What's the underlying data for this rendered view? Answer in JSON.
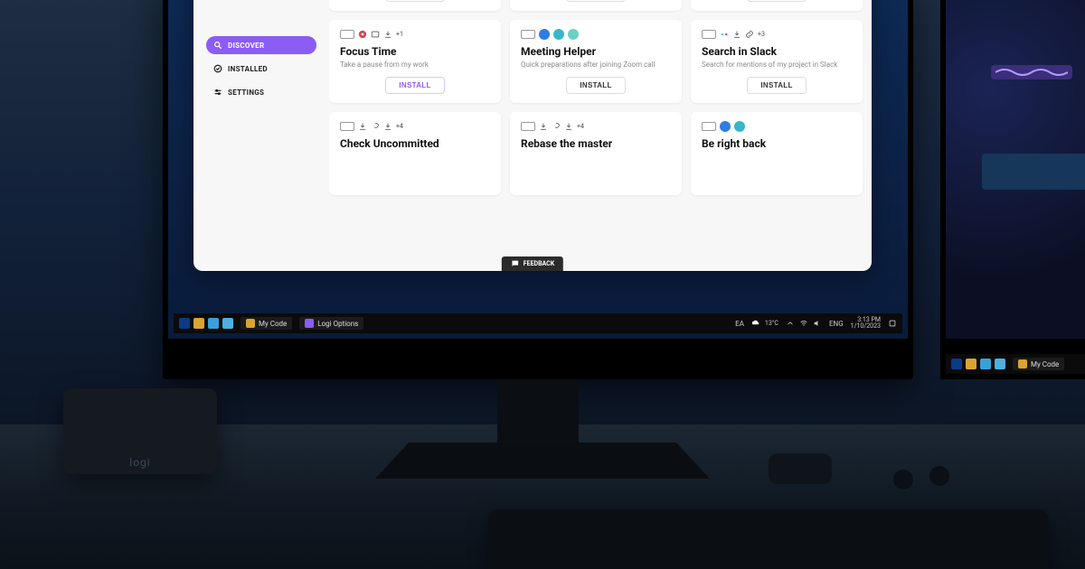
{
  "sidebar": {
    "items": [
      {
        "label": "DISCOVER",
        "icon": "search-icon",
        "active": true
      },
      {
        "label": "INSTALLED",
        "icon": "check-circle-icon",
        "active": false
      },
      {
        "label": "SETTINGS",
        "icon": "sliders-icon",
        "active": false
      }
    ]
  },
  "buttons": {
    "install": "INSTALL",
    "feedback": "FEEDBACK"
  },
  "cards_row1": [
    {
      "install": true
    },
    {
      "install": true
    },
    {
      "install": true
    }
  ],
  "cards_row2": [
    {
      "title": "Focus Time",
      "desc": "Take a pause from my work",
      "badge": "+1",
      "accent": true
    },
    {
      "title": "Meeting Helper",
      "desc": "Quick preparations after joining Zoom call",
      "badge": ""
    },
    {
      "title": "Search in Slack",
      "desc": "Search for mentions of my project in Slack",
      "badge": "+3"
    }
  ],
  "cards_row3": [
    {
      "title": "Check Uncommitted",
      "badge": "+4"
    },
    {
      "title": "Rebase the master",
      "badge": "+4"
    },
    {
      "title": "Be right back",
      "badge": ""
    }
  ],
  "taskbar": {
    "app1": "My Code",
    "app2": "Logi Options",
    "lang_short": "EA",
    "weather": "13°C",
    "lang": "ENG",
    "time": "3:13 PM",
    "date": "1/10/2023"
  },
  "taskbar2": {
    "app1": "My Code"
  },
  "brand": {
    "speaker": "logi"
  }
}
